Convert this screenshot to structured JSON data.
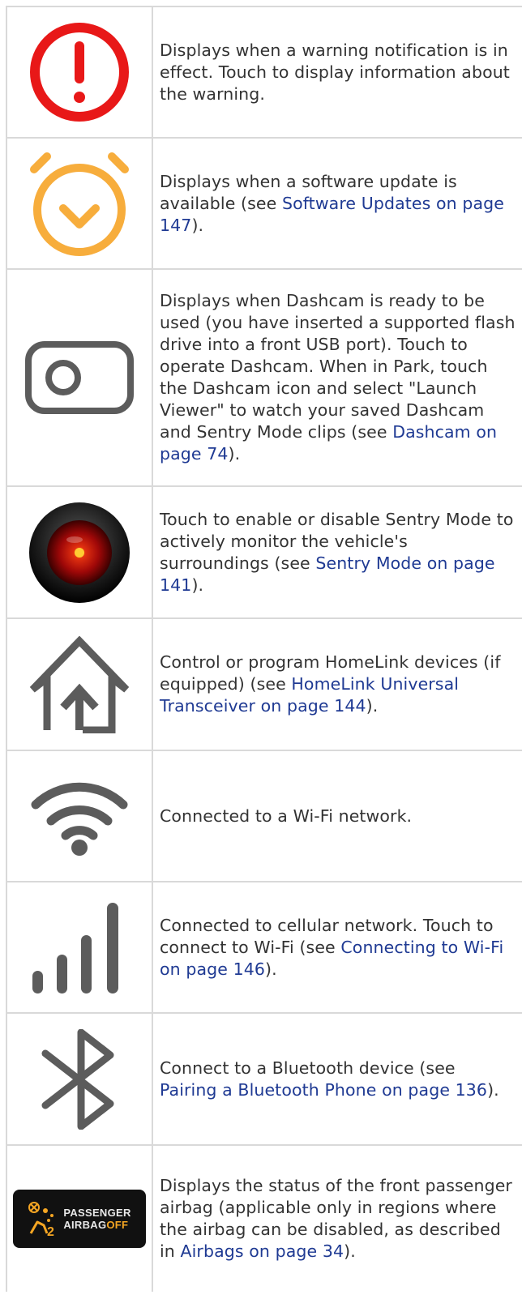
{
  "rows": [
    {
      "icon": "warning-exclamation-icon",
      "parts": [
        "Displays when a warning notification is in effect. Touch to display information about the warning."
      ]
    },
    {
      "icon": "alarm-clock-icon",
      "parts": [
        "Displays when a software update is available (see ",
        "Software Updates on page 147",
        ")."
      ]
    },
    {
      "icon": "dashcam-icon",
      "parts": [
        "Displays when Dashcam is ready to be used (you have inserted a supported flash drive into a front USB port). Touch to operate Dashcam. When in Park, touch the Dashcam icon and select \"Launch Viewer\" to watch your saved Dashcam and Sentry Mode clips (see ",
        "Dashcam on page 74",
        ")."
      ]
    },
    {
      "icon": "sentry-mode-icon",
      "parts": [
        "Touch to enable or disable Sentry Mode to actively monitor the vehicle's surroundings (see ",
        "Sentry Mode on page 141",
        ")."
      ]
    },
    {
      "icon": "homelink-icon",
      "parts": [
        "Control or program HomeLink devices (if equipped) (see ",
        "HomeLink Universal Transceiver on page 144",
        ")."
      ]
    },
    {
      "icon": "wifi-icon",
      "parts": [
        "Connected to a Wi-Fi network."
      ]
    },
    {
      "icon": "cellular-signal-icon",
      "parts": [
        "Connected to cellular network. Touch to connect to Wi-Fi (see ",
        "Connecting to Wi-Fi on page 146",
        ")."
      ]
    },
    {
      "icon": "bluetooth-icon",
      "parts": [
        "Connect to a Bluetooth device (see ",
        "Pairing a Bluetooth Phone on page 136",
        ")."
      ]
    },
    {
      "icon": "passenger-airbag-off-icon",
      "parts": [
        "Displays the status of the front passenger airbag (applicable only in regions where the airbag can be disabled, as described in ",
        "Airbags on page 34",
        ")."
      ]
    }
  ],
  "airbag_badge": {
    "line1": "PASSENGER",
    "line2a": "AIRBAG",
    "line2b": "OFF",
    "seat_number": "2"
  },
  "colors": {
    "warning": "#e81818",
    "alarm": "#f7ad3c",
    "icon_gray": "#5c5c5c",
    "link": "#1f3a93",
    "sentry_red": "#c41010",
    "airbag_off": "#f5a623"
  }
}
